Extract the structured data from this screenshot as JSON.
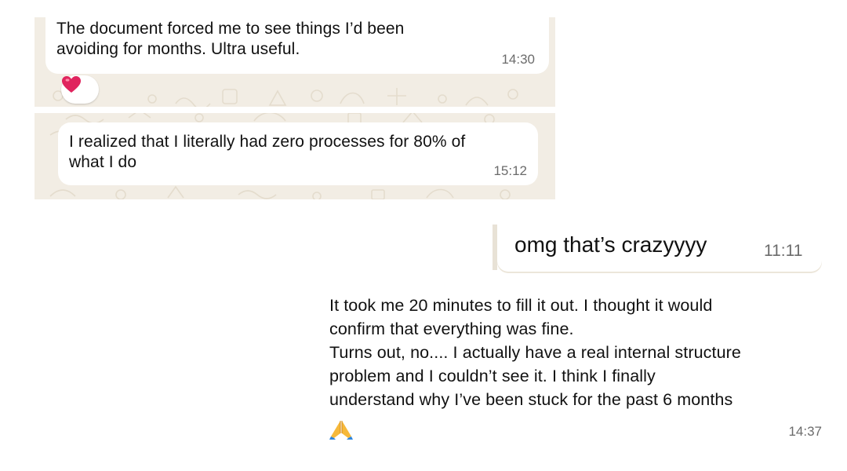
{
  "messages": [
    {
      "text": "The document forced me to see things I’d been avoiding for months. Ultra useful.",
      "line1": "The document forced me to see things I’d been",
      "line2": "avoiding for months. Ultra useful.",
      "time": "14:30",
      "reaction": "heart-emoji"
    },
    {
      "line1": "I realized that I literally had zero processes for 80% of",
      "line2": "what I do",
      "time": "15:12"
    },
    {
      "text": "omg that’s crazyyyy",
      "time": "11:11"
    },
    {
      "line1": "It took me 20 minutes to fill it out. I thought it would",
      "line2": "confirm that everything was fine.",
      "line3": "Turns out, no.... I actually have a real internal structure",
      "line4": "problem and I couldn’t see it.  I think I finally",
      "line5": "understand why I’ve been stuck for the past 6 months",
      "emoji": "folded-hands-emoji",
      "time": "14:37"
    }
  ],
  "colors": {
    "wallpaper": "#f2ede4",
    "bubble": "#ffffff",
    "timestamp": "#6b6b6b",
    "heart": "#e0245e"
  }
}
